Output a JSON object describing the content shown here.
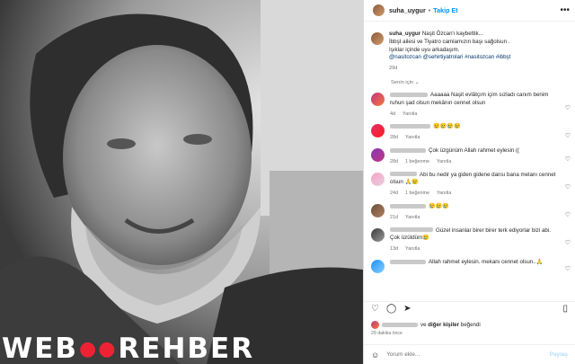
{
  "post": {
    "username": "suha_uygur",
    "separator": "•",
    "follow_label": "Takip Et",
    "more_icon": "more-horizontal-icon"
  },
  "caption": {
    "username": "suha_uygur",
    "line1": "Naşit Özcan'ı kaybettik...",
    "line2": "İbbşt ailesi ve Tiyatro camiamızın başı sağolsun .",
    "line3": "Işıklar içinde uyu arkadaşım.",
    "tags": "@nasitozcan @sehirtiyatrolari #nasitozcan #ibbşt",
    "time": "29d"
  },
  "senin_icin": "Senin için ⌄",
  "comments": [
    {
      "text": "Aaaaaa Naşit evlâtçım içim sızladı canım benim ruhun şad olsun mekânın cennet olsun",
      "time": "4d",
      "likes": "",
      "reply": "Yanıtla"
    },
    {
      "text": "😢😢😢😢",
      "time": "28d",
      "likes": "",
      "reply": "Yanıtla"
    },
    {
      "text": "Çok üzgünüm Allah rahmet eylesin ((",
      "time": "28d",
      "likes": "1 beğenme",
      "reply": "Yanıtla"
    },
    {
      "text": "Abi bu nedir ya giden gidene dansı bana melanı cennet olsun 🙏😢",
      "time": "24d",
      "likes": "1 beğenme",
      "reply": "Yanıtla"
    },
    {
      "text": "😢😢😢",
      "time": "21d",
      "likes": "",
      "reply": "Yanıtla"
    },
    {
      "text": "Güzel insanlar birer birer terk ediyorlar bizi abi. Çok üzüldüm😢",
      "time": "13d",
      "likes": "",
      "reply": "Yanıtla"
    },
    {
      "text": "Allah rahmet eylesin. mekanı cennet olsun..🙏",
      "time": "",
      "likes": "",
      "reply": ""
    }
  ],
  "likes_text": "ve",
  "likes_bold": "diğer kişiler",
  "likes_suffix": "beğendi",
  "posted_ago": "29 dakika önce",
  "comment_placeholder": "Yorum ekle...",
  "post_button": "Paylaş",
  "watermark": {
    "left": "WEB",
    "right": "EHBER"
  }
}
